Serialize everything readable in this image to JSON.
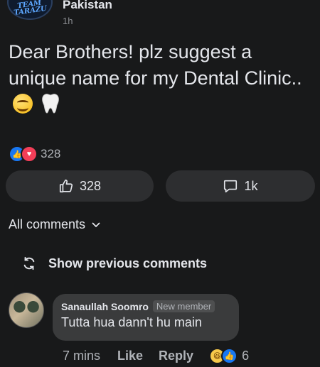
{
  "post": {
    "page_name": "Pakistan",
    "logo_text": "TEAM TARAZU",
    "time": "1h",
    "text": "Dear Brothers! plz suggest a unique name for my Dental Clinic..",
    "emojis": [
      "smiling-face-icon",
      "tooth-icon"
    ],
    "reaction_count": "328",
    "like_count": "328",
    "comment_count": "1k"
  },
  "comments_section": {
    "filter_label": "All comments",
    "show_previous_label": "Show previous comments",
    "comment": {
      "author": "Sanaullah Soomro",
      "badge": "New member",
      "text": "Tutta hua dann't hu main",
      "time": "7 mins",
      "like_label": "Like",
      "reply_label": "Reply",
      "reaction_count": "6"
    }
  },
  "colors": {
    "background": "#18191a",
    "button_bg": "#2d2e30",
    "bubble_bg": "#3a3b3c",
    "like_blue": "#1877f2",
    "love_red": "#f33e58"
  }
}
